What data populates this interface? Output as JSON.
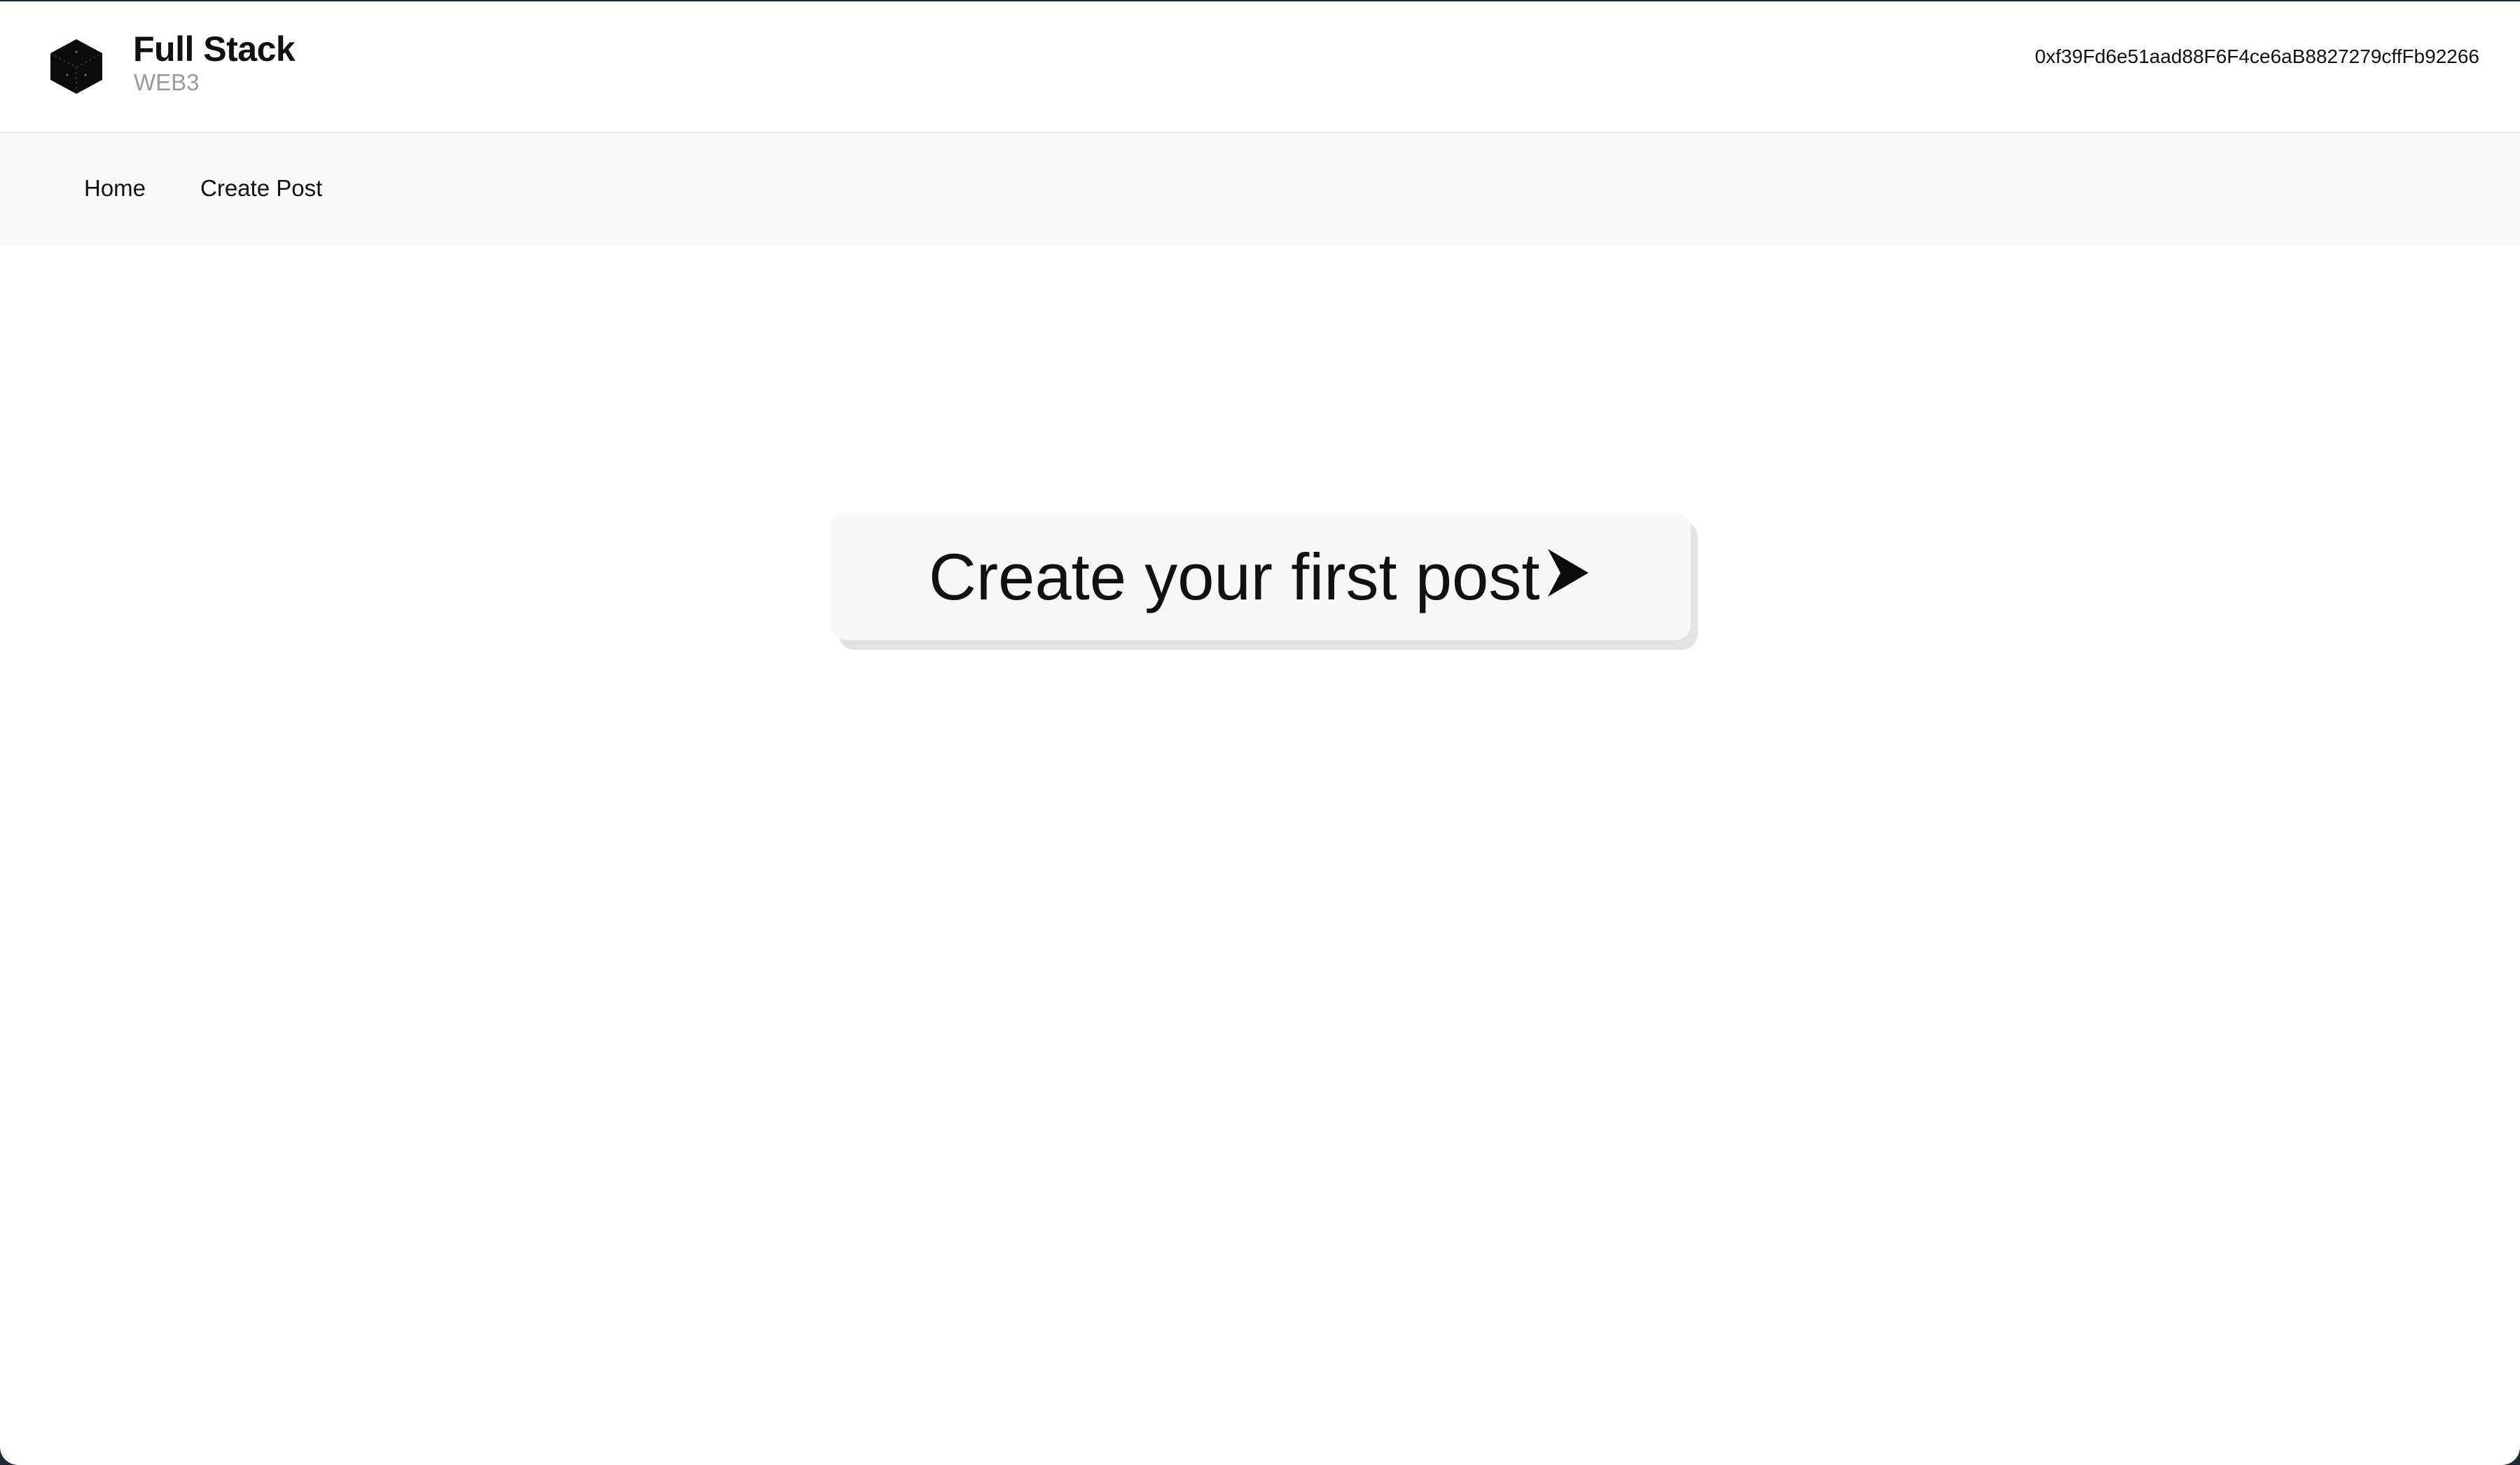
{
  "header": {
    "brand_title": "Full Stack",
    "brand_subtitle": "WEB3",
    "account_address": "0xf39Fd6e51aad88F6F4ce6aB8827279cffFb92266",
    "logo_icon": "cube-icon"
  },
  "nav": {
    "items": [
      {
        "label": "Home"
      },
      {
        "label": "Create Post"
      }
    ]
  },
  "main": {
    "cta_label": "Create your first post",
    "cta_icon": "arrow-right-icon"
  },
  "colors": {
    "background": "#ffffff",
    "navbar": "#f9f9f9",
    "button": "#f7f7f7",
    "button_shadow": "#e3e3e3",
    "text": "#111111",
    "subtitle": "#9a9a9a"
  }
}
